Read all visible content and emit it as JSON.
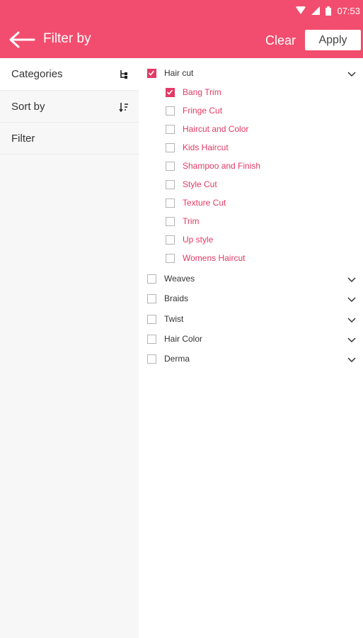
{
  "status": {
    "time": "07:53"
  },
  "app_bar": {
    "title": "Filter by",
    "clear_label": "Clear",
    "apply_label": "Apply"
  },
  "sidebar": {
    "items": [
      {
        "label": "Categories",
        "active": true
      },
      {
        "label": "Sort by",
        "active": false
      },
      {
        "label": "Filter",
        "active": false
      }
    ]
  },
  "categories": {
    "hair_cut": {
      "label": "Hair cut",
      "checked": true,
      "expanded": true,
      "subitems": [
        {
          "label": "Bang Trim",
          "checked": true
        },
        {
          "label": "Fringe Cut",
          "checked": false
        },
        {
          "label": "Haircut and Color",
          "checked": false
        },
        {
          "label": "Kids Haircut",
          "checked": false
        },
        {
          "label": "Shampoo and Finish",
          "checked": false
        },
        {
          "label": "Style Cut",
          "checked": false
        },
        {
          "label": "Texture Cut",
          "checked": false
        },
        {
          "label": "Trim",
          "checked": false
        },
        {
          "label": "Up style",
          "checked": false
        },
        {
          "label": "Womens Haircut",
          "checked": false
        }
      ]
    },
    "others": [
      {
        "label": "Weaves",
        "checked": false
      },
      {
        "label": "Braids",
        "checked": false
      },
      {
        "label": "Twist",
        "checked": false
      },
      {
        "label": "Hair Color",
        "checked": false
      },
      {
        "label": "Derma",
        "checked": false
      }
    ]
  },
  "colors": {
    "accent": "#f24d6e",
    "check": "#e23a64"
  }
}
